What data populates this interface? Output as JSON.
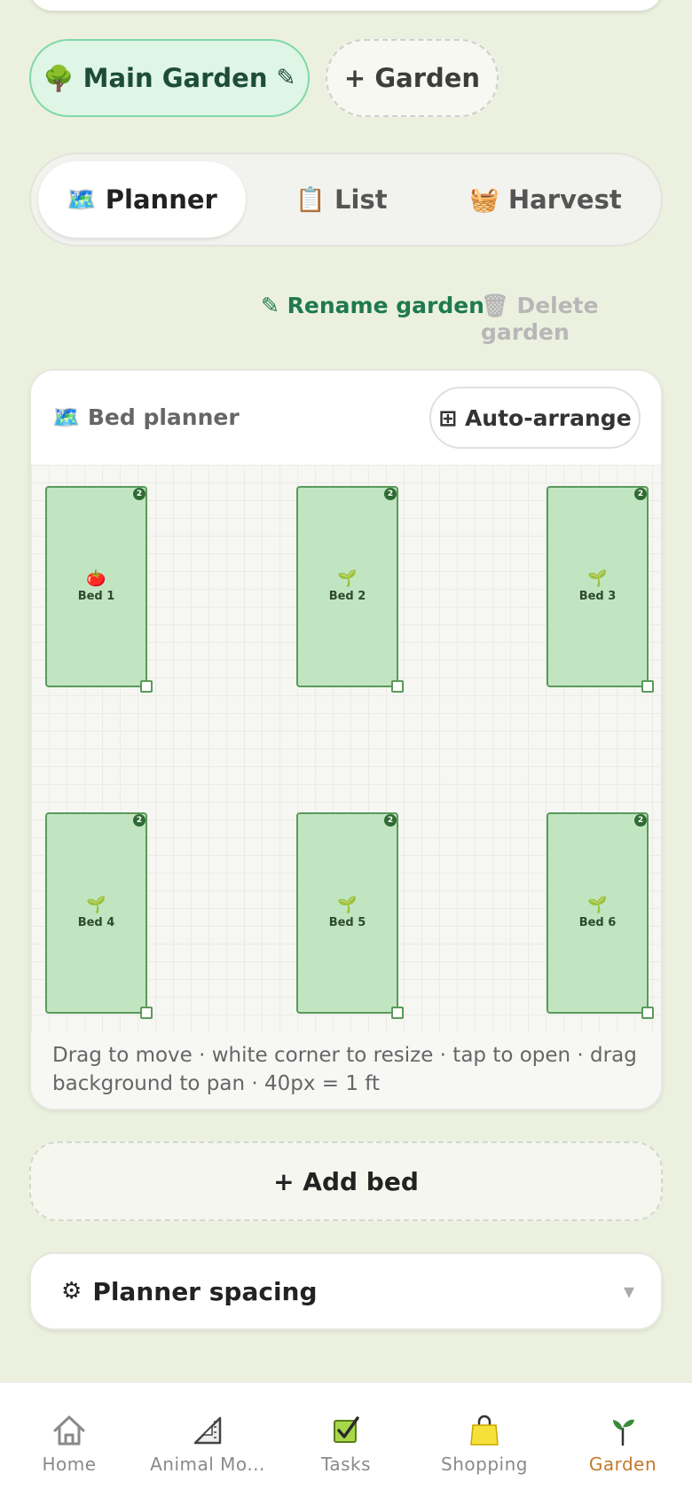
{
  "garden_chips": {
    "active_icon": "🌳",
    "active_label": "Main Garden",
    "edit_icon": "✎",
    "add_label": "+ Garden"
  },
  "tabs": [
    {
      "icon": "🗺️",
      "label": "Planner",
      "active": true
    },
    {
      "icon": "📋",
      "label": "List",
      "active": false
    },
    {
      "icon": "🧺",
      "label": "Harvest",
      "active": false
    }
  ],
  "actions": {
    "rename": "✎ Rename garden",
    "delete": "🗑 Delete garden"
  },
  "planner": {
    "icon": "🗺️",
    "title": "Bed planner",
    "auto_arrange": "⊞ Auto-arrange",
    "beds": [
      {
        "label": "Bed 1",
        "icon": "🍅",
        "count": "2"
      },
      {
        "label": "Bed 2",
        "icon": "🌱",
        "count": "2"
      },
      {
        "label": "Bed 3",
        "icon": "🌱",
        "count": "2"
      },
      {
        "label": "Bed 4",
        "icon": "🌱",
        "count": "2"
      },
      {
        "label": "Bed 5",
        "icon": "🌱",
        "count": "2"
      },
      {
        "label": "Bed 6",
        "icon": "🌱",
        "count": "2"
      }
    ],
    "hint": "Drag to move · white corner to resize · tap to open · drag background to pan · 40px = 1 ft"
  },
  "add_bed": "+ Add bed",
  "spacing": {
    "icon": "⚙",
    "label": "Planner spacing",
    "caret": "▾"
  },
  "nav": [
    {
      "label": "Home",
      "icon": "home-icon",
      "active": false
    },
    {
      "label": "Animal Mo...",
      "icon": "ruler-triangle-icon",
      "active": false
    },
    {
      "label": "Tasks",
      "icon": "checkbox-icon",
      "active": false
    },
    {
      "label": "Shopping",
      "icon": "shopping-bag-icon",
      "active": false
    },
    {
      "label": "Garden",
      "icon": "seedling-icon",
      "active": true
    }
  ],
  "colors": {
    "background": "#ecf1df",
    "accent_green": "#1f7a4e",
    "bed_fill": "#c1e5c1",
    "nav_active": "#c47a2a"
  }
}
